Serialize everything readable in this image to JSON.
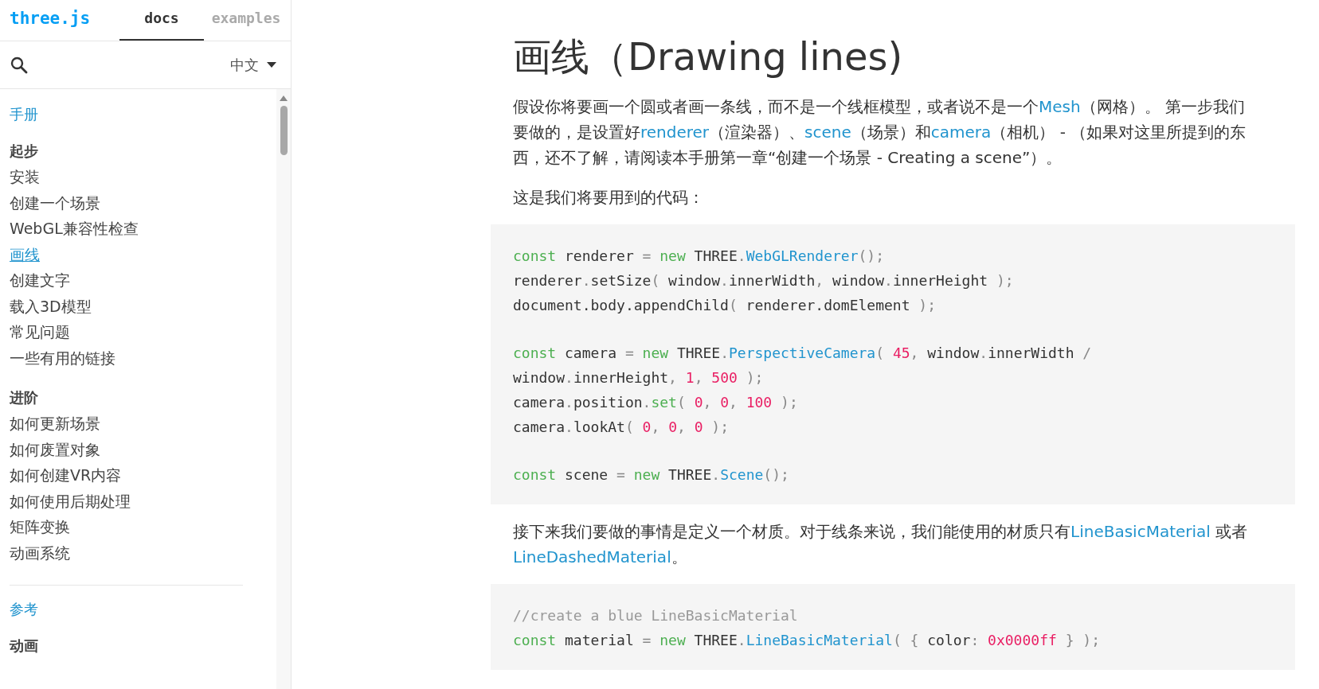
{
  "header": {
    "logo": "three.js",
    "tabs": [
      {
        "label": "docs",
        "selected": true
      },
      {
        "label": "examples",
        "selected": false
      }
    ]
  },
  "search": {
    "language": "中文"
  },
  "nav": [
    {
      "kind": "category",
      "label": "手册"
    },
    {
      "kind": "heading",
      "label": "起步"
    },
    {
      "kind": "item",
      "label": "安装",
      "selected": false
    },
    {
      "kind": "item",
      "label": "创建一个场景",
      "selected": false
    },
    {
      "kind": "item",
      "label": "WebGL兼容性检查",
      "selected": false
    },
    {
      "kind": "item",
      "label": "画线",
      "selected": true
    },
    {
      "kind": "item",
      "label": "创建文字",
      "selected": false
    },
    {
      "kind": "item",
      "label": "载入3D模型",
      "selected": false
    },
    {
      "kind": "item",
      "label": "常见问题",
      "selected": false
    },
    {
      "kind": "item",
      "label": "一些有用的链接",
      "selected": false
    },
    {
      "kind": "heading",
      "label": "进阶"
    },
    {
      "kind": "item",
      "label": "如何更新场景",
      "selected": false
    },
    {
      "kind": "item",
      "label": "如何废置对象",
      "selected": false
    },
    {
      "kind": "item",
      "label": "如何创建VR内容",
      "selected": false
    },
    {
      "kind": "item",
      "label": "如何使用后期处理",
      "selected": false
    },
    {
      "kind": "item",
      "label": "矩阵变换",
      "selected": false
    },
    {
      "kind": "item",
      "label": "动画系统",
      "selected": false
    },
    {
      "kind": "divider"
    },
    {
      "kind": "category",
      "label": "参考"
    },
    {
      "kind": "heading",
      "label": "动画"
    }
  ],
  "article": {
    "title": "画线（Drawing lines)",
    "blocks": [
      {
        "kind": "paragraph",
        "segments": [
          {
            "text": "假设你将要画一个圆或者画一条线，而不是一个线框模型，或者说不是一个",
            "link": false
          },
          {
            "text": "Mesh",
            "link": true
          },
          {
            "text": "（网格）。 第一步我们要做的，是设置好",
            "link": false
          },
          {
            "text": "renderer",
            "link": true
          },
          {
            "text": "（渲染器）、",
            "link": false
          },
          {
            "text": "scene",
            "link": true
          },
          {
            "text": "（场景）和",
            "link": false
          },
          {
            "text": "camera",
            "link": true
          },
          {
            "text": "（相机） - （如果对这里所提到的东西，还不了解，请阅读本手册第一章“创建一个场景 - Creating a scene”）。",
            "link": false
          }
        ]
      },
      {
        "kind": "paragraph",
        "segments": [
          {
            "text": "这是我们将要用到的代码：",
            "link": false
          }
        ]
      },
      {
        "kind": "code",
        "groups": [
          [
            [
              {
                "kind": "keyword",
                "text": "const"
              },
              {
                "kind": "plain",
                "text": " renderer "
              },
              {
                "kind": "punct",
                "text": "= "
              },
              {
                "kind": "keyword",
                "text": "new"
              },
              {
                "kind": "plain",
                "text": " THREE"
              },
              {
                "kind": "punct",
                "text": "."
              },
              {
                "kind": "class",
                "text": "WebGLRenderer"
              },
              {
                "kind": "punct",
                "text": "();"
              }
            ],
            [
              {
                "kind": "plain",
                "text": "renderer"
              },
              {
                "kind": "punct",
                "text": "."
              },
              {
                "kind": "plain",
                "text": "setSize"
              },
              {
                "kind": "punct",
                "text": "("
              },
              {
                "kind": "plain",
                "text": " window"
              },
              {
                "kind": "punct",
                "text": "."
              },
              {
                "kind": "plain",
                "text": "innerWidth"
              },
              {
                "kind": "punct",
                "text": ","
              },
              {
                "kind": "plain",
                "text": " window"
              },
              {
                "kind": "punct",
                "text": "."
              },
              {
                "kind": "plain",
                "text": "innerHeight "
              },
              {
                "kind": "punct",
                "text": ");"
              }
            ],
            [
              {
                "kind": "plain",
                "text": "document.body.appendChild"
              },
              {
                "kind": "punct",
                "text": "("
              },
              {
                "kind": "plain",
                "text": " renderer.domElement "
              },
              {
                "kind": "punct",
                "text": ");"
              }
            ]
          ],
          [
            [
              {
                "kind": "keyword",
                "text": "const"
              },
              {
                "kind": "plain",
                "text": " camera "
              },
              {
                "kind": "punct",
                "text": "= "
              },
              {
                "kind": "keyword",
                "text": "new"
              },
              {
                "kind": "plain",
                "text": " THREE"
              },
              {
                "kind": "punct",
                "text": "."
              },
              {
                "kind": "class",
                "text": "PerspectiveCamera"
              },
              {
                "kind": "punct",
                "text": "( "
              },
              {
                "kind": "number",
                "text": "45"
              },
              {
                "kind": "punct",
                "text": ","
              },
              {
                "kind": "plain",
                "text": " window"
              },
              {
                "kind": "punct",
                "text": "."
              },
              {
                "kind": "plain",
                "text": "innerWidth "
              },
              {
                "kind": "punct",
                "text": "/"
              }
            ],
            [
              {
                "kind": "plain",
                "text": "window"
              },
              {
                "kind": "punct",
                "text": "."
              },
              {
                "kind": "plain",
                "text": "innerHeight"
              },
              {
                "kind": "punct",
                "text": ", "
              },
              {
                "kind": "number",
                "text": "1"
              },
              {
                "kind": "punct",
                "text": ", "
              },
              {
                "kind": "number",
                "text": "500"
              },
              {
                "kind": "punct",
                "text": " );"
              }
            ],
            [
              {
                "kind": "plain",
                "text": "camera"
              },
              {
                "kind": "punct",
                "text": "."
              },
              {
                "kind": "plain",
                "text": "position"
              },
              {
                "kind": "punct",
                "text": "."
              },
              {
                "kind": "keyword",
                "text": "set"
              },
              {
                "kind": "punct",
                "text": "( "
              },
              {
                "kind": "number",
                "text": "0"
              },
              {
                "kind": "punct",
                "text": ", "
              },
              {
                "kind": "number",
                "text": "0"
              },
              {
                "kind": "punct",
                "text": ", "
              },
              {
                "kind": "number",
                "text": "100"
              },
              {
                "kind": "punct",
                "text": " );"
              }
            ],
            [
              {
                "kind": "plain",
                "text": "camera"
              },
              {
                "kind": "punct",
                "text": "."
              },
              {
                "kind": "plain",
                "text": "lookAt"
              },
              {
                "kind": "punct",
                "text": "( "
              },
              {
                "kind": "number",
                "text": "0"
              },
              {
                "kind": "punct",
                "text": ", "
              },
              {
                "kind": "number",
                "text": "0"
              },
              {
                "kind": "punct",
                "text": ", "
              },
              {
                "kind": "number",
                "text": "0"
              },
              {
                "kind": "punct",
                "text": " );"
              }
            ]
          ],
          [
            [
              {
                "kind": "keyword",
                "text": "const"
              },
              {
                "kind": "plain",
                "text": " scene "
              },
              {
                "kind": "punct",
                "text": "= "
              },
              {
                "kind": "keyword",
                "text": "new"
              },
              {
                "kind": "plain",
                "text": " THREE"
              },
              {
                "kind": "punct",
                "text": "."
              },
              {
                "kind": "class",
                "text": "Scene"
              },
              {
                "kind": "punct",
                "text": "();"
              }
            ]
          ]
        ]
      },
      {
        "kind": "paragraph",
        "segments": [
          {
            "text": "接下来我们要做的事情是定义一个材质。对于线条来说，我们能使用的材质只有",
            "link": false
          },
          {
            "text": "LineBasicMaterial",
            "link": true
          },
          {
            "text": " 或者",
            "link": false
          },
          {
            "text": "LineDashedMaterial",
            "link": true
          },
          {
            "text": "。",
            "link": false
          }
        ]
      },
      {
        "kind": "code",
        "groups": [
          [
            [
              {
                "kind": "comment",
                "text": "//create a blue LineBasicMaterial"
              }
            ],
            [
              {
                "kind": "keyword",
                "text": "const"
              },
              {
                "kind": "plain",
                "text": " material "
              },
              {
                "kind": "punct",
                "text": "= "
              },
              {
                "kind": "keyword",
                "text": "new"
              },
              {
                "kind": "plain",
                "text": " THREE"
              },
              {
                "kind": "punct",
                "text": "."
              },
              {
                "kind": "class",
                "text": "LineBasicMaterial"
              },
              {
                "kind": "punct",
                "text": "( { "
              },
              {
                "kind": "plain",
                "text": "color"
              },
              {
                "kind": "punct",
                "text": ": "
              },
              {
                "kind": "number",
                "text": "0x0000ff"
              },
              {
                "kind": "punct",
                "text": " } );"
              }
            ]
          ]
        ]
      }
    ]
  }
}
